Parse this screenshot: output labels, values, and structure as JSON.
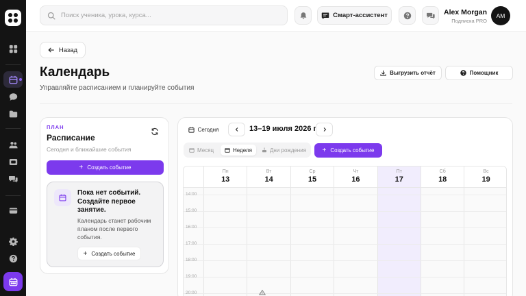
{
  "topbar": {
    "search_placeholder": "Поиск ученика, урока, курса...",
    "assistant_label": "Смарт-ассистент",
    "user_name": "Alex Morgan",
    "user_plan": "Подписка PRO",
    "avatar_initials": "AM"
  },
  "header": {
    "back_label": "Назад",
    "title": "Календарь",
    "subtitle": "Управляйте расписанием и планируйте события",
    "export_label": "Выгрузить отчёт",
    "helper_label": "Помощник"
  },
  "plan_card": {
    "eyebrow": "ПЛАН",
    "title": "Расписание",
    "subtitle": "Сегодня и ближайшие события",
    "create_label": "Создать событие",
    "empty_title": "Пока нет событий. Создайте первое занятие.",
    "empty_text": "Календарь станет рабочим планом после первого события.",
    "empty_create_label": "Создать событие"
  },
  "calendar": {
    "today_label": "Сегодня",
    "range": "13–19 июля 2026 г.",
    "views": [
      "Месяц",
      "Неделя",
      "Дни рождения"
    ],
    "active_view": "Неделя",
    "create_label": "Создать событие",
    "days": [
      {
        "dow": "Пн",
        "num": "13"
      },
      {
        "dow": "Вт",
        "num": "14"
      },
      {
        "dow": "Ср",
        "num": "15"
      },
      {
        "dow": "Чт",
        "num": "16"
      },
      {
        "dow": "Пт",
        "num": "17"
      },
      {
        "dow": "Сб",
        "num": "18"
      },
      {
        "dow": "Вс",
        "num": "19"
      }
    ],
    "selected_day": "17",
    "hours": [
      "14:00",
      "15:00",
      "16:00",
      "17:00",
      "18:00",
      "19:00",
      "20:00"
    ]
  },
  "colors": {
    "accent": "#7c3aed",
    "rail": "#141414",
    "selected_column": "#f1edfd"
  },
  "icons": {
    "rail": [
      "grid-icon",
      "calendar-icon",
      "chat-icon",
      "folder-icon",
      "users-icon",
      "book-icon",
      "messages-icon",
      "card-icon",
      "settings-icon",
      "help-icon"
    ]
  }
}
